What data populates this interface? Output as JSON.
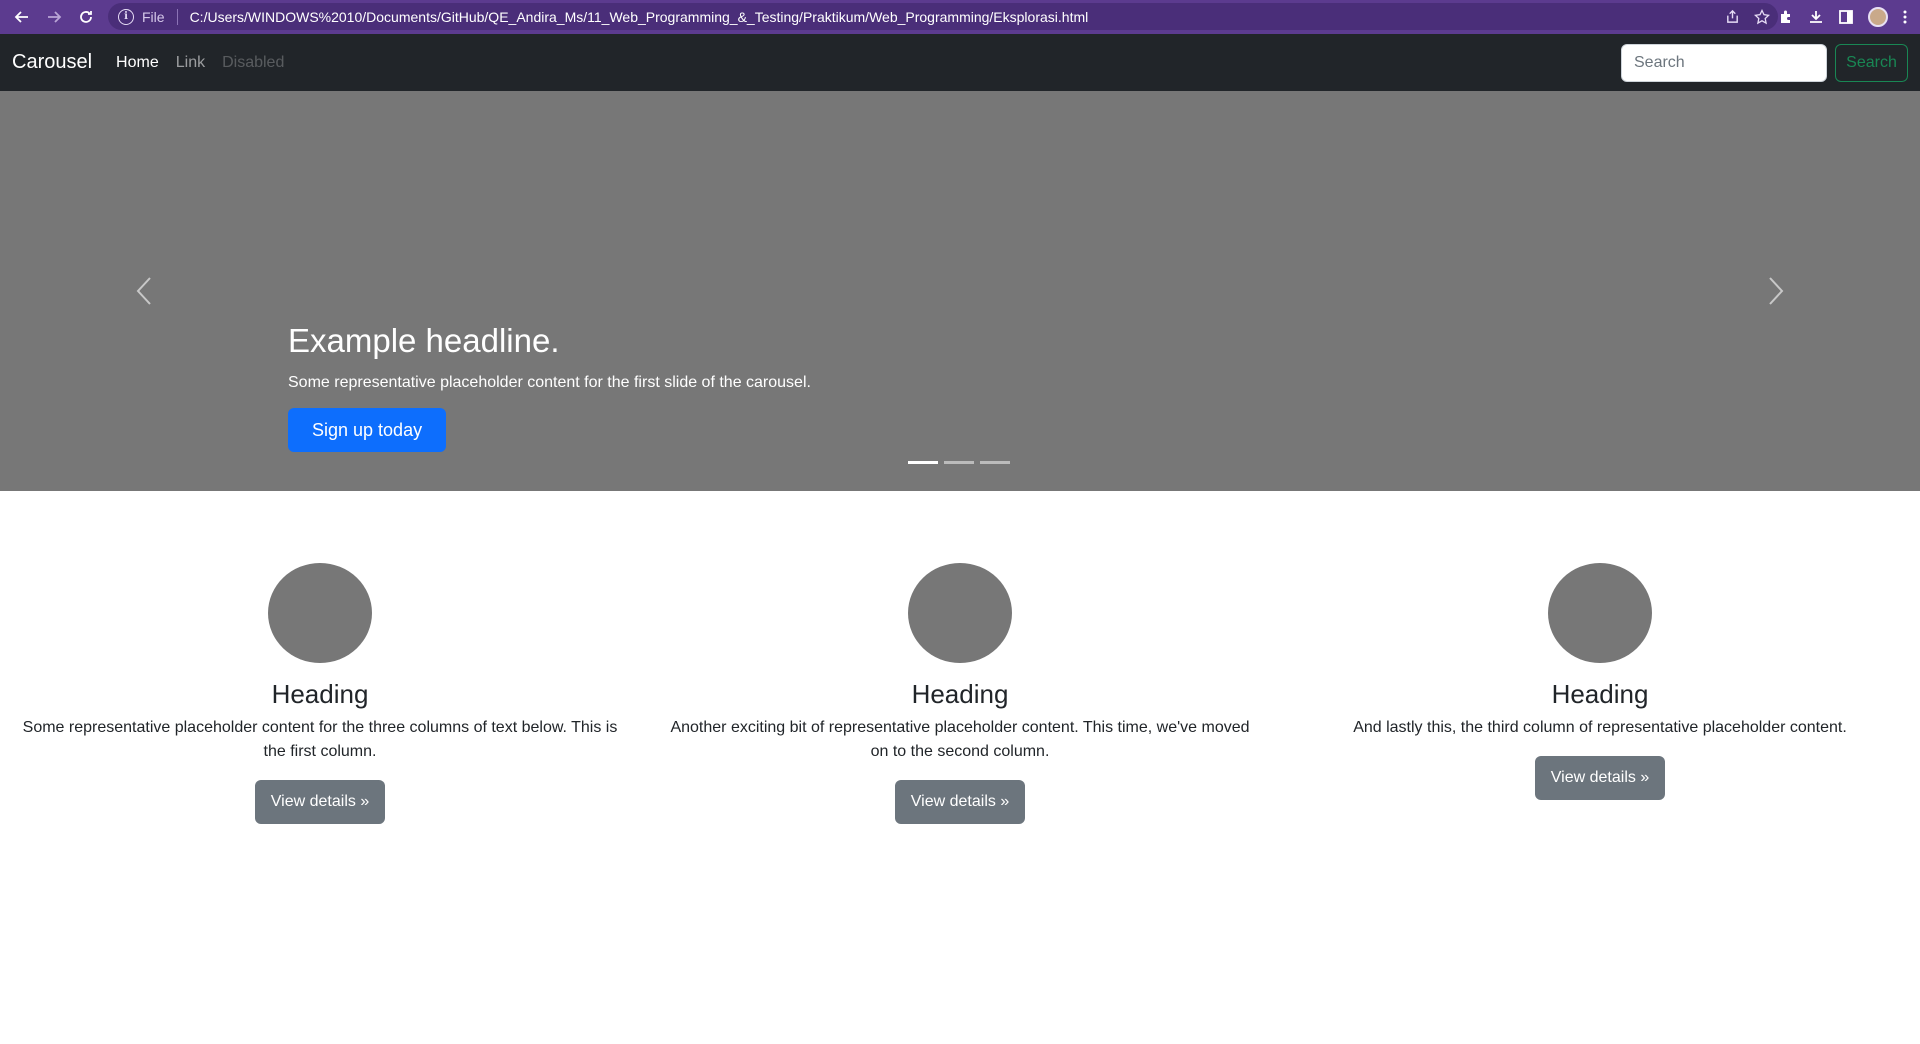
{
  "browser": {
    "scheme": "File",
    "url": "C:/Users/WINDOWS%2010/Documents/GitHub/QE_Andira_Ms/11_Web_Programming_&_Testing/Praktikum/Web_Programming/Eksplorasi.html"
  },
  "navbar": {
    "brand": "Carousel",
    "links": [
      {
        "label": "Home",
        "state": "active"
      },
      {
        "label": "Link",
        "state": "normal"
      },
      {
        "label": "Disabled",
        "state": "disabled"
      }
    ],
    "search": {
      "placeholder": "Search",
      "value": "",
      "button_label": "Search"
    }
  },
  "carousel": {
    "headline": "Example headline.",
    "text": "Some representative placeholder content for the first slide of the carousel.",
    "button_label": "Sign up today",
    "slides_total": 3,
    "active_slide": 1
  },
  "columns": [
    {
      "heading": "Heading",
      "text": "Some representative placeholder content for the three columns of text below. This is the first column.",
      "button_label": "View details »"
    },
    {
      "heading": "Heading",
      "text": "Another exciting bit of representative placeholder content. This time, we've moved on to the second column.",
      "button_label": "View details »"
    },
    {
      "heading": "Heading",
      "text": "And lastly this, the third column of representative placeholder content.",
      "button_label": "View details »"
    }
  ],
  "colors": {
    "toolbar": "#5c3b8f",
    "navbar": "#212529",
    "carousel_bg": "#777777",
    "primary": "#0d6efd",
    "success": "#198754",
    "secondary": "#6c757d"
  }
}
